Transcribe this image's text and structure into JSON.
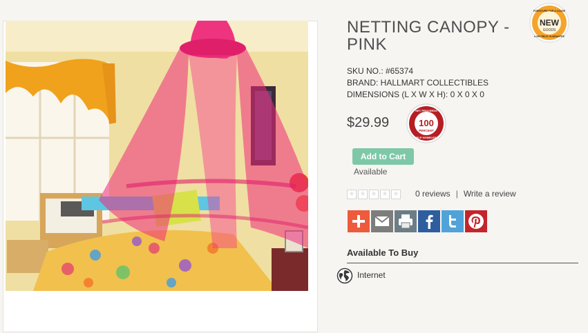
{
  "product": {
    "title": "NETTING CANOPY - PINK",
    "sku": "SKU NO.: #65374",
    "brand": "BRAND: HALLMART COLLECTIBLES",
    "dimensions": "DIMENSIONS (L X W X H): 0 X 0 X 0",
    "price": "$29.99"
  },
  "badges": {
    "new_badge": {
      "top_text": "FURNITURE FOR A CAUSE",
      "main_text": "NEW",
      "sub_text": "GOODS",
      "bottom_text": "LOW PRICE GUARANTEE"
    },
    "proceeds_badge": {
      "top_text": "NET PROCEEDS",
      "main_text": "100",
      "sub_text": "PERCENT",
      "bottom_text": "HELP HOMELESS"
    }
  },
  "cart": {
    "add_label": "Add to Cart",
    "availability": "Available"
  },
  "reviews": {
    "stars_filled": 0,
    "stars_total": 5,
    "count_text": "0 reviews",
    "separator": "|",
    "write_link": "Write a review"
  },
  "share": [
    {
      "icon": "plus-icon",
      "color": "#ee5a3c"
    },
    {
      "icon": "email-icon",
      "color": "#7d7d7d"
    },
    {
      "icon": "print-icon",
      "color": "#6d7d86"
    },
    {
      "icon": "facebook-icon",
      "color": "#2e5e9e"
    },
    {
      "icon": "twitter-icon",
      "color": "#4fa3d9"
    },
    {
      "icon": "pinterest-icon",
      "color": "#c3252c"
    }
  ],
  "available_to_buy": {
    "heading": "Available To Buy",
    "channels": [
      {
        "icon": "globe-icon",
        "label": "Internet"
      }
    ]
  },
  "colors": {
    "add_to_cart": "#7ec8a8",
    "canopy_pink": "#ee2a7b",
    "badge_red": "#b51f24",
    "badge_orange": "#f3a42c"
  }
}
